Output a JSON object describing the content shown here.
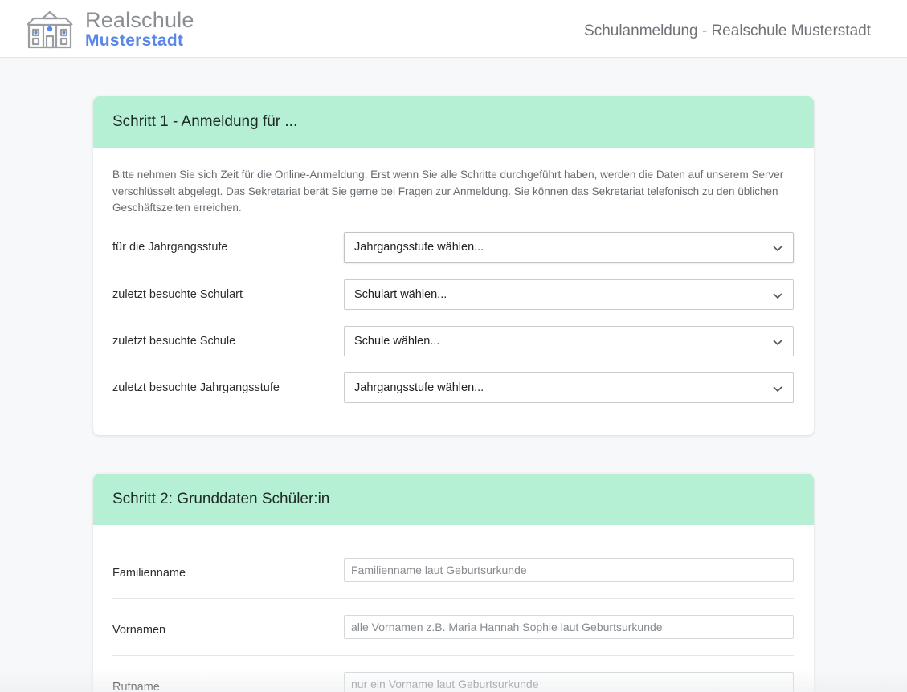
{
  "header": {
    "logo_line1": "Realschule",
    "logo_line2": "Musterstadt",
    "page_title": "Schulanmeldung - Realschule Musterstadt"
  },
  "colors": {
    "card_header_bg": "#b6f0d4",
    "logo_accent": "#5a86e8",
    "logo_gray": "#8a8d91"
  },
  "step1": {
    "title": "Schritt 1 - Anmeldung für ...",
    "intro": "Bitte nehmen Sie sich Zeit für die Online-Anmeldung. Erst wenn Sie alle Schritte durchgeführt haben, werden die Daten auf unserem Server verschlüsselt abgelegt. Das Sekretariat berät Sie gerne bei Fragen zur Anmeldung. Sie können das Sekretariat telefonisch zu den üblichen Geschäftszeiten erreichen.",
    "fields": [
      {
        "label": "für die Jahrgangsstufe",
        "selected": "Jahrgangsstufe wählen..."
      },
      {
        "label": "zuletzt besuchte Schulart",
        "selected": "Schulart wählen..."
      },
      {
        "label": "zuletzt besuchte Schule",
        "selected": "Schule wählen..."
      },
      {
        "label": "zuletzt besuchte Jahrgangsstufe",
        "selected": "Jahrgangsstufe wählen..."
      }
    ]
  },
  "step2": {
    "title": "Schritt 2: Grunddaten Schüler:in",
    "fields": [
      {
        "label": "Familienname",
        "placeholder": "Familienname laut Geburtsurkunde",
        "value": ""
      },
      {
        "label": "Vornamen",
        "placeholder": "alle Vornamen z.B. Maria Hannah Sophie laut Geburtsurkunde",
        "value": ""
      },
      {
        "label": "Rufname",
        "placeholder": "nur ein Vorname laut Geburtsurkunde",
        "value": ""
      }
    ]
  }
}
